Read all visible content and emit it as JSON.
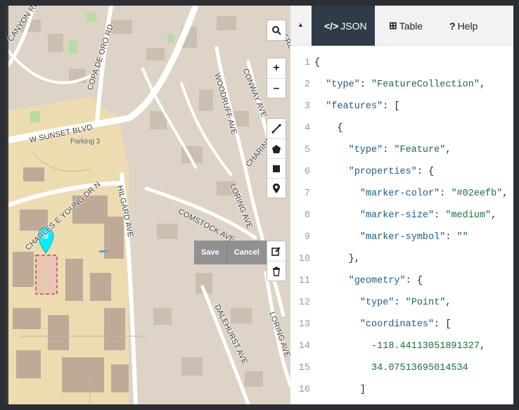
{
  "map": {
    "road_labels": [
      {
        "text": "CANYON RD"
      },
      {
        "text": "COPA DE ORO RD"
      },
      {
        "text": "W SUNSET BLVD"
      },
      {
        "text": "CHARLES E YOUNG DR N"
      },
      {
        "text": "HILGARD AVE"
      },
      {
        "text": "WOODRUFF AVE"
      },
      {
        "text": "CONWAY AVE"
      },
      {
        "text": "LORING AVE"
      },
      {
        "text": "COMSTOCK AVE"
      },
      {
        "text": "CHARING"
      },
      {
        "text": "DALEHURST AVE"
      },
      {
        "text": "LORING AVE"
      },
      {
        "text": "BEVERLY"
      }
    ],
    "poi_label": "Parking 3",
    "marker_color": "#02eefb",
    "edit_actions": {
      "save": "Save",
      "cancel": "Cancel"
    },
    "toolbar_icons": [
      "search-icon",
      "zoom-in-icon",
      "zoom-out-icon",
      "draw-line-icon",
      "draw-polygon-icon",
      "draw-rectangle-icon",
      "draw-marker-icon",
      "edit-layers-icon",
      "delete-layers-icon"
    ]
  },
  "panel": {
    "collapse_glyph": "▲",
    "tabs": [
      {
        "icon": "</>",
        "label": "JSON",
        "active": true
      },
      {
        "icon": "⊞",
        "label": "Table",
        "active": false
      },
      {
        "icon": "?",
        "label": "Help",
        "active": false
      }
    ],
    "code_lines": [
      {
        "n": "1",
        "parts": [
          [
            "p",
            "{"
          ]
        ]
      },
      {
        "n": "2",
        "parts": [
          [
            "p",
            "  "
          ],
          [
            "k",
            "\"type\""
          ],
          [
            "p",
            ": "
          ],
          [
            "s",
            "\"FeatureCollection\""
          ],
          [
            "p",
            ","
          ]
        ]
      },
      {
        "n": "3",
        "parts": [
          [
            "p",
            "  "
          ],
          [
            "k",
            "\"features\""
          ],
          [
            "p",
            ": ["
          ]
        ]
      },
      {
        "n": "4",
        "parts": [
          [
            "p",
            "    {"
          ]
        ]
      },
      {
        "n": "5",
        "parts": [
          [
            "p",
            "      "
          ],
          [
            "k",
            "\"type\""
          ],
          [
            "p",
            ": "
          ],
          [
            "s",
            "\"Feature\""
          ],
          [
            "p",
            ","
          ]
        ]
      },
      {
        "n": "6",
        "parts": [
          [
            "p",
            "      "
          ],
          [
            "k",
            "\"properties\""
          ],
          [
            "p",
            ": {"
          ]
        ]
      },
      {
        "n": "7",
        "parts": [
          [
            "p",
            "        "
          ],
          [
            "k",
            "\"marker-color\""
          ],
          [
            "p",
            ": "
          ],
          [
            "s",
            "\"#02eefb\""
          ],
          [
            "p",
            ","
          ]
        ]
      },
      {
        "n": "8",
        "parts": [
          [
            "p",
            "        "
          ],
          [
            "k",
            "\"marker-size\""
          ],
          [
            "p",
            ": "
          ],
          [
            "s",
            "\"medium\""
          ],
          [
            "p",
            ","
          ]
        ]
      },
      {
        "n": "9",
        "parts": [
          [
            "p",
            "        "
          ],
          [
            "k",
            "\"marker-symbol\""
          ],
          [
            "p",
            ": "
          ],
          [
            "s",
            "\"\""
          ]
        ]
      },
      {
        "n": "10",
        "parts": [
          [
            "p",
            "      },"
          ]
        ]
      },
      {
        "n": "11",
        "parts": [
          [
            "p",
            "      "
          ],
          [
            "k",
            "\"geometry\""
          ],
          [
            "p",
            ": {"
          ]
        ]
      },
      {
        "n": "12",
        "parts": [
          [
            "p",
            "        "
          ],
          [
            "k",
            "\"type\""
          ],
          [
            "p",
            ": "
          ],
          [
            "s",
            "\"Point\""
          ],
          [
            "p",
            ","
          ]
        ]
      },
      {
        "n": "13",
        "parts": [
          [
            "p",
            "        "
          ],
          [
            "k",
            "\"coordinates\""
          ],
          [
            "p",
            ": ["
          ]
        ]
      },
      {
        "n": "14",
        "parts": [
          [
            "p",
            "          "
          ],
          [
            "n",
            "-118.44113051891327"
          ],
          [
            "p",
            ","
          ]
        ]
      },
      {
        "n": "15",
        "parts": [
          [
            "p",
            "          "
          ],
          [
            "n",
            "34.07513695014534"
          ]
        ]
      },
      {
        "n": "16",
        "parts": [
          [
            "p",
            "        ]"
          ]
        ]
      }
    ]
  }
}
